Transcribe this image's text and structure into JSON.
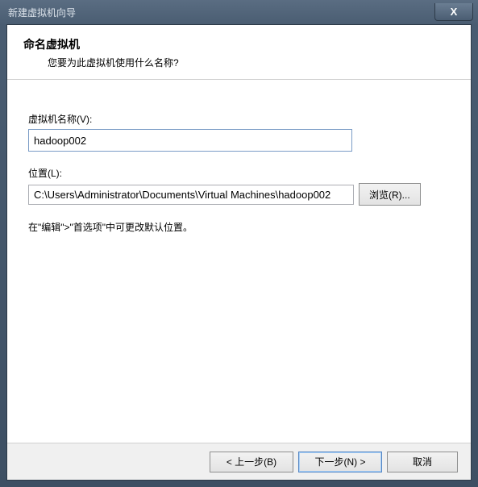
{
  "window": {
    "title": "新建虚拟机向导",
    "close_symbol": "X"
  },
  "header": {
    "title": "命名虚拟机",
    "subtitle": "您要为此虚拟机使用什么名称?"
  },
  "form": {
    "vm_name_label": "虚拟机名称(V):",
    "vm_name_value": "hadoop002",
    "location_label": "位置(L):",
    "location_value": "C:\\Users\\Administrator\\Documents\\Virtual Machines\\hadoop002",
    "browse_label": "浏览(R)...",
    "hint": "在\"编辑\">\"首选项\"中可更改默认位置。"
  },
  "buttons": {
    "back": "< 上一步(B)",
    "next": "下一步(N) >",
    "cancel": "取消"
  }
}
